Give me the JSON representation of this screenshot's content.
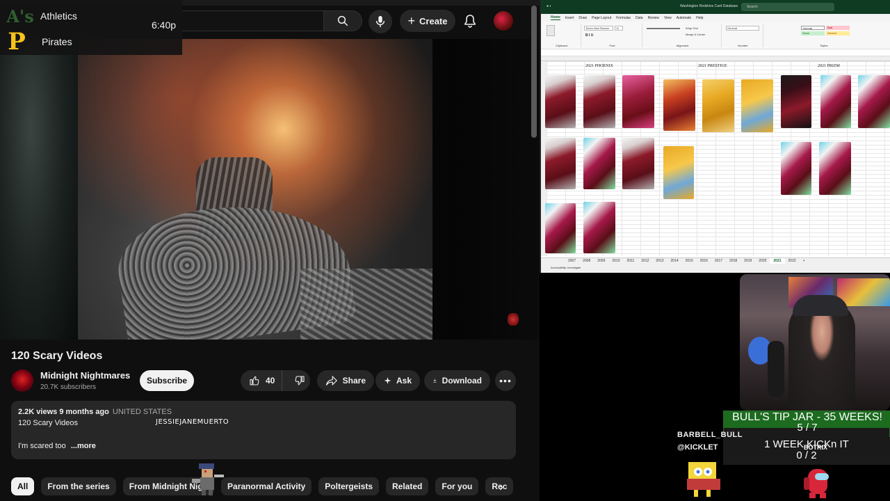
{
  "scoreboard": {
    "team1": "Athletics",
    "team2": "Pirates",
    "time": "6:40p"
  },
  "header": {
    "create_label": "Create"
  },
  "video": {
    "title": "120 Scary Videos",
    "channel": "Midnight Nightmares",
    "subscribers": "20.7K subscribers",
    "subscribe_label": "Subscribe",
    "likes": "40",
    "share_label": "Share",
    "ask_label": "Ask",
    "download_label": "Download"
  },
  "description": {
    "views": "2.2K views",
    "age": "9 months ago",
    "country": "UNITED STATES",
    "line1": "120 Scary Videos",
    "overlay_name": "JESSIEJANEMUERTO",
    "line2": "I'm scared too",
    "more": "...more"
  },
  "chips": [
    "All",
    "From the series",
    "From Midnight Nigh",
    "Paranormal Activity",
    "Poltergeists",
    "Related",
    "For you",
    "Rec"
  ],
  "excel": {
    "window_title": "Washington Redskins Card Database",
    "search_placeholder": "Search",
    "menu": [
      "Home",
      "Insert",
      "Draw",
      "Page Layout",
      "Formulas",
      "Data",
      "Review",
      "View",
      "Automate",
      "Help"
    ],
    "ribbon": {
      "font_name": "Times New Roman",
      "font_size": "11",
      "wrap_text": "Wrap Text",
      "merge_center": "Merge & Center",
      "number_format": "General",
      "style_normal": "Normal",
      "style_bad": "Bad",
      "style_good": "Good",
      "style_neutral": "Neutral",
      "groups": [
        "Clipboard",
        "Font",
        "Alignment",
        "Number",
        "Styles"
      ]
    },
    "sections": [
      "2021 PHOENIX",
      "2021 PRESTIGE",
      "2021 PRIZM"
    ],
    "sheet_tabs": [
      "2007",
      "2008",
      "2009",
      "2010",
      "2011",
      "2012",
      "2013",
      "2014",
      "2015",
      "2016",
      "2017",
      "2018",
      "2019",
      "2020",
      "2021",
      "2022"
    ],
    "active_tab": "2021",
    "status": "Accessibility: Investigate"
  },
  "stream": {
    "tip_jar": "BULL'S TIP JAR - 35 WEEKS!",
    "tip_count": "5 / 7",
    "kick_goal": "1 WEEK KICKn IT",
    "kick_count": "0 / 2",
    "bot_name": "BOTRIX",
    "user1": "BARBELL_BULL",
    "user2": "@KICKLET"
  },
  "colors": {
    "yt_bg": "#0f0f0f",
    "excel_green": "#0e3b22",
    "tip_green": "#1c6b1f"
  }
}
